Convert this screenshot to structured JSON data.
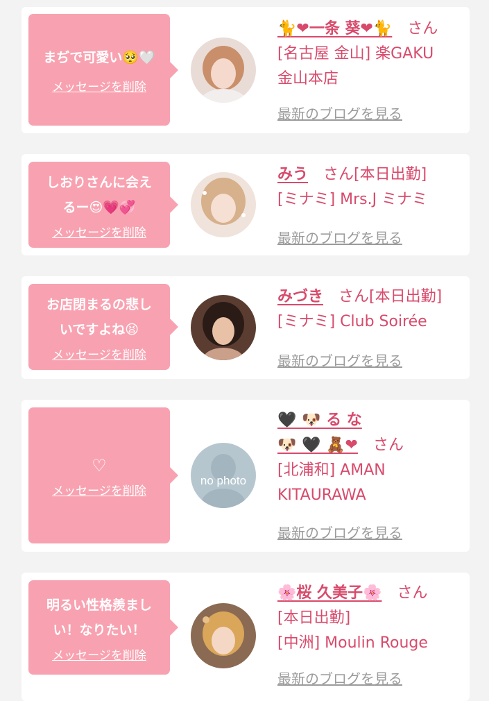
{
  "colors": {
    "bubble": "#f8a2b1",
    "accent": "#d84a6b",
    "link_gray": "#9b9b9b",
    "background": "#f3f3f3"
  },
  "delete_label": "メッセージを削除",
  "blog_label": "最新のブログを見る",
  "cards": [
    {
      "message_lines": [
        "まぢで可愛い🥺🤍"
      ],
      "name": "🐈❤一条 葵❤🐈",
      "san": "さん",
      "info_lines": [
        "[名古屋 金山] 楽GAKU",
        "金山本店"
      ],
      "avatar": "profile-photo"
    },
    {
      "message_lines": [
        "しおりさんに会え",
        "るー😍💗💞"
      ],
      "name": "みう",
      "san": "さん[本日出勤]",
      "info_lines": [
        "[ミナミ] Mrs.J ミナミ"
      ],
      "avatar": "profile-photo"
    },
    {
      "message_lines": [
        "お店閉まるの悲し",
        "いですよね😫"
      ],
      "name": "みづき",
      "san": "さん[本日出勤]",
      "info_lines": [
        "[ミナミ] Club Soirée"
      ],
      "avatar": "profile-photo"
    },
    {
      "message_lines": [
        "♡"
      ],
      "name_line1": "🖤 🐶 る な",
      "name_line2": "🐶 🖤 🧸❤",
      "san": "さん",
      "info_lines": [
        "[北浦和] AMAN",
        "KITAURAWA"
      ],
      "avatar": "no photo"
    },
    {
      "message_lines": [
        "明るい性格羨まし",
        "い！なりたい！"
      ],
      "name": "🌸桜 久美子🌸",
      "san": "さん",
      "info_lines": [
        "[本日出勤]",
        "[中洲] Moulin Rouge"
      ],
      "avatar": "profile-photo"
    }
  ]
}
